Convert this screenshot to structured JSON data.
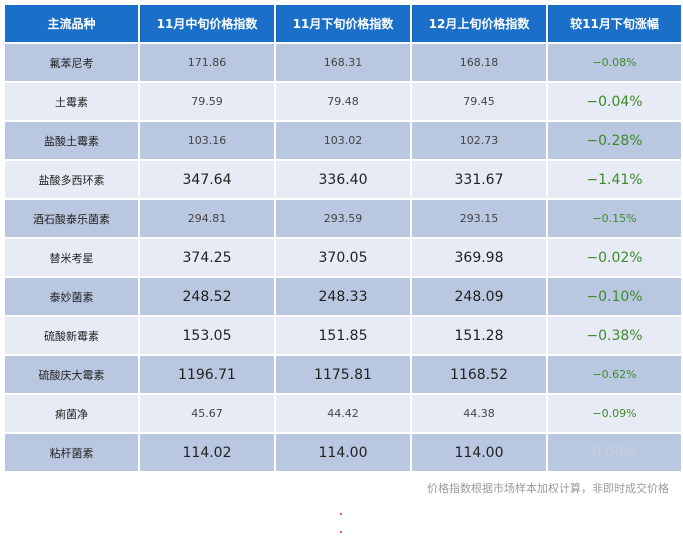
{
  "table": {
    "headers": [
      "主流品种",
      "11月中旬价格指数",
      "11月下旬价格指数",
      "12月上旬价格指数",
      "较11月下旬涨幅"
    ],
    "rows": [
      {
        "name": "氟苯尼考",
        "mid_nov": "171.86",
        "late_nov": "168.31",
        "early_dec": "168.18",
        "change": "−0.08%"
      },
      {
        "name": "土霉素",
        "mid_nov": "79.59",
        "late_nov": "79.48",
        "early_dec": "79.45",
        "change": "−0.04%"
      },
      {
        "name": "盐酸土霉素",
        "mid_nov": "103.16",
        "late_nov": "103.02",
        "early_dec": "102.73",
        "change": "−0.28%"
      },
      {
        "name": "盐酸多西环素",
        "mid_nov": "347.64",
        "late_nov": "336.40",
        "early_dec": "331.67",
        "change": "−1.41%"
      },
      {
        "name": "酒石酸泰乐菌素",
        "mid_nov": "294.81",
        "late_nov": "293.59",
        "early_dec": "293.15",
        "change": "−0.15%"
      },
      {
        "name": "替米考星",
        "mid_nov": "374.25",
        "late_nov": "370.05",
        "early_dec": "369.98",
        "change": "−0.02%"
      },
      {
        "name": "泰妙菌素",
        "mid_nov": "248.52",
        "late_nov": "248.33",
        "early_dec": "248.09",
        "change": "−0.10%"
      },
      {
        "name": "硫酸新霉素",
        "mid_nov": "153.05",
        "late_nov": "151.85",
        "early_dec": "151.28",
        "change": "−0.38%"
      },
      {
        "name": "硫酸庆大霉素",
        "mid_nov": "1196.71",
        "late_nov": "1175.81",
        "early_dec": "1168.52",
        "change": "−0.62%"
      },
      {
        "name": "痢菌净",
        "mid_nov": "45.67",
        "late_nov": "44.42",
        "early_dec": "44.38",
        "change": "−0.09%"
      },
      {
        "name": "粘杆菌素",
        "mid_nov": "114.02",
        "late_nov": "114.00",
        "early_dec": "114.00",
        "change": "0.00%"
      }
    ]
  },
  "footnote": "价格指数根据市场样本加权计算，非即时成交价格",
  "colors": {
    "header_bg": "#1a6fc9",
    "row_dark": "#b9c7e1",
    "row_light": "#e6ebf5",
    "change_text": "#3f8a2a",
    "change_muted": "#c9cfd8"
  }
}
